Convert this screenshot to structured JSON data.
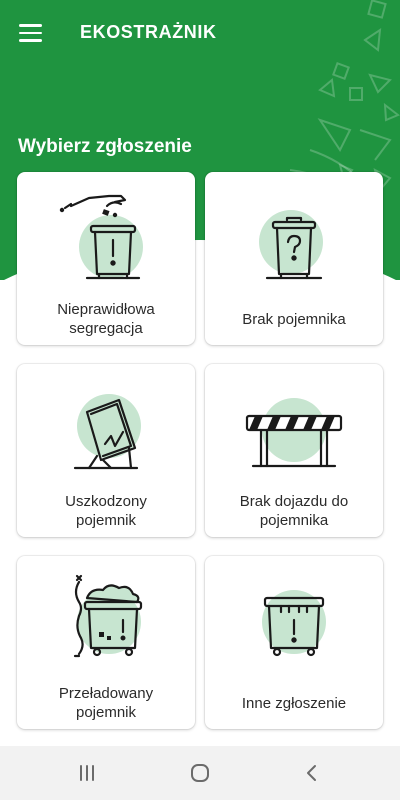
{
  "app": {
    "title": "EKOSTRAŻNIK",
    "menu_icon": "hamburger-menu-icon",
    "brand_color": "#1f9440",
    "accent_light": "#c7e5d0"
  },
  "section": {
    "title": "Wybierz zgłoszenie"
  },
  "cards": [
    {
      "icon": "wrong-segregation-icon",
      "line1": "Nieprawidłowa",
      "line2": "segregacja"
    },
    {
      "icon": "missing-bin-icon",
      "line1": "Brak pojemnika",
      "line2": ""
    },
    {
      "icon": "damaged-bin-icon",
      "line1": "Uszkodzony",
      "line2": "pojemnik"
    },
    {
      "icon": "no-access-barrier-icon",
      "line1": "Brak dojazdu do",
      "line2": "pojemnika"
    },
    {
      "icon": "overfilled-bin-icon",
      "line1": "Przeładowany",
      "line2": "pojemnik"
    },
    {
      "icon": "other-report-icon",
      "line1": "Inne zgłoszenie",
      "line2": ""
    }
  ],
  "system_nav": {
    "recents_icon": "recents-icon",
    "home_icon": "home-icon",
    "back_icon": "back-icon"
  }
}
